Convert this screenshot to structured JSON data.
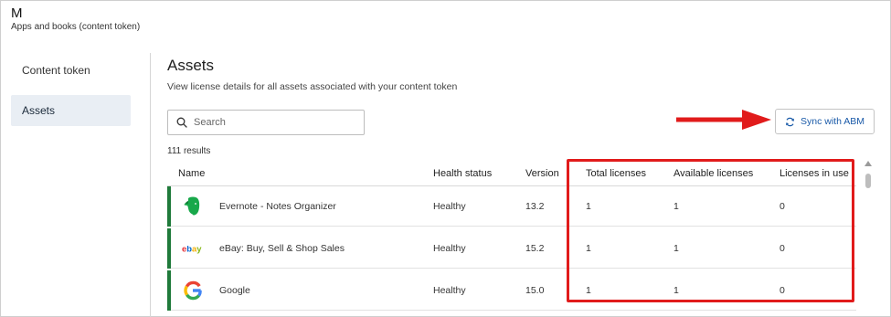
{
  "header": {
    "title": "M",
    "subtitle": "Apps and books (content token)"
  },
  "sidebar": {
    "items": [
      {
        "label": "Content token",
        "active": false
      },
      {
        "label": "Assets",
        "active": true
      }
    ]
  },
  "main": {
    "title": "Assets",
    "description": "View license details for all assets associated with your content token",
    "search_placeholder": "Search",
    "sync_label": "Sync with ABM",
    "results_count": "111 results"
  },
  "table": {
    "columns": [
      "Name",
      "Health status",
      "Version",
      "Total licenses",
      "Available licenses",
      "Licenses in use"
    ],
    "rows": [
      {
        "name": "Evernote - Notes Organizer",
        "icon": "evernote-icon",
        "health": "Healthy",
        "version": "13.2",
        "total": "1",
        "available": "1",
        "in_use": "0"
      },
      {
        "name": "eBay: Buy, Sell & Shop Sales",
        "icon": "ebay-icon",
        "health": "Healthy",
        "version": "15.2",
        "total": "1",
        "available": "1",
        "in_use": "0"
      },
      {
        "name": "Google",
        "icon": "google-icon",
        "health": "Healthy",
        "version": "15.0",
        "total": "1",
        "available": "1",
        "in_use": "0"
      }
    ]
  },
  "colors": {
    "accent_green": "#1f7a3a",
    "annotation_red": "#e11b1b",
    "link_blue": "#1a5aa8",
    "active_nav": "#e9eef4"
  }
}
